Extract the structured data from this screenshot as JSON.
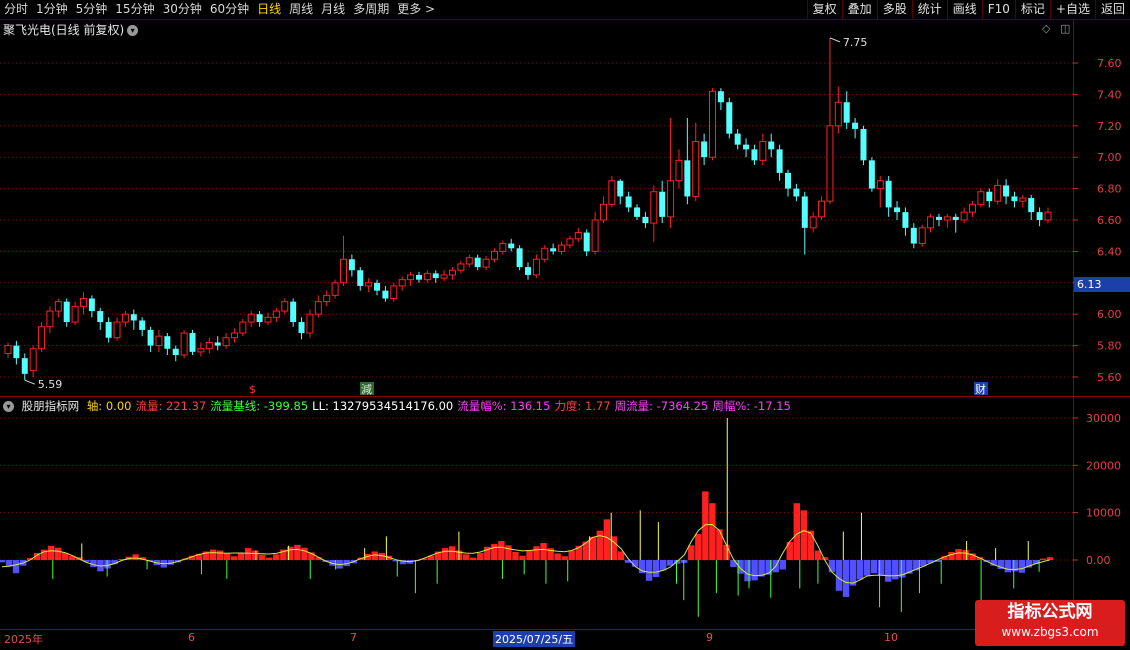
{
  "toolbar": {
    "periods": [
      "分时",
      "1分钟",
      "5分钟",
      "15分钟",
      "30分钟",
      "60分钟",
      "日线",
      "周线",
      "月线",
      "多周期",
      "更多 >"
    ],
    "active_period": "日线",
    "tools": [
      "复权",
      "叠加",
      "多股",
      "统计",
      "画线",
      "F10",
      "标记",
      "+自选",
      "返回"
    ]
  },
  "stock": {
    "title": "聚飞光电(日线 前复权)"
  },
  "price_axis": {
    "ticks": [
      "7.60",
      "7.40",
      "7.20",
      "7.00",
      "6.80",
      "6.60",
      "6.40",
      "6.20",
      "6.00",
      "5.80",
      "5.60"
    ],
    "current": "6.13"
  },
  "annotations": {
    "high": "7.75",
    "low": "5.59"
  },
  "event_markers": [
    {
      "text": "$",
      "color": "#ff3030"
    },
    {
      "text": "減",
      "color": "#e0e0e0",
      "bg": "#2a6e2a"
    },
    {
      "text": "财",
      "color": "#ffffff",
      "bg": "#1c3fa8"
    }
  ],
  "indicator": {
    "name": "股朋指标网",
    "fields": [
      {
        "label": "轴:",
        "value": "0.00",
        "color": "#ffd700"
      },
      {
        "label": "流量:",
        "value": "221.37",
        "color": "#ff4040"
      },
      {
        "label": "流量基线:",
        "value": "-399.85",
        "color": "#40ff40"
      },
      {
        "label": "LL:",
        "value": "13279534514176.00",
        "color": "#ffffff"
      },
      {
        "label": "流量幅%:",
        "value": "136.15",
        "color": "#ff40ff"
      },
      {
        "label": "力度:",
        "value": "1.77",
        "color": "#ff4040"
      },
      {
        "label": "周流量:",
        "value": "-7364.25",
        "color": "#ff40ff"
      },
      {
        "label": "周幅%:",
        "value": "-17.15",
        "color": "#ff40ff"
      }
    ],
    "axis_ticks": [
      "30000",
      "20000",
      "10000",
      "0.00"
    ]
  },
  "date_axis": {
    "labels": [
      "2025年",
      "6",
      "7",
      "9",
      "10"
    ],
    "cursor": "2025/07/25/五"
  },
  "watermark": {
    "line1": "指标公式网",
    "line2": "www.zbgs3.com"
  },
  "colors": {
    "up": "#ff2020",
    "down": "#54ffff",
    "flow_pos": "#ff2020",
    "flow_neg": "#5050ff",
    "baseline": "#40ff40"
  },
  "chart_data": {
    "type": "candlestick",
    "price_range": [
      5.55,
      7.78
    ],
    "candles": [
      [
        5.75,
        5.8,
        5.72,
        5.82
      ],
      [
        5.8,
        5.72,
        5.68,
        5.83
      ],
      [
        5.72,
        5.62,
        5.58,
        5.75
      ],
      [
        5.64,
        5.78,
        5.6,
        5.8
      ],
      [
        5.78,
        5.92,
        5.76,
        5.95
      ],
      [
        5.92,
        6.02,
        5.88,
        6.05
      ],
      [
        6.02,
        6.08,
        5.98,
        6.1
      ],
      [
        6.08,
        5.95,
        5.92,
        6.1
      ],
      [
        5.95,
        6.05,
        5.93,
        6.08
      ],
      [
        6.05,
        6.1,
        6.0,
        6.14
      ],
      [
        6.1,
        6.02,
        5.98,
        6.12
      ],
      [
        6.02,
        5.95,
        5.9,
        6.04
      ],
      [
        5.95,
        5.85,
        5.82,
        5.98
      ],
      [
        5.85,
        5.95,
        5.83,
        5.98
      ],
      [
        5.95,
        6.0,
        5.92,
        6.02
      ],
      [
        6.0,
        5.96,
        5.9,
        6.03
      ],
      [
        5.96,
        5.9,
        5.86,
        5.98
      ],
      [
        5.9,
        5.8,
        5.76,
        5.92
      ],
      [
        5.8,
        5.86,
        5.76,
        5.9
      ],
      [
        5.86,
        5.78,
        5.74,
        5.88
      ],
      [
        5.78,
        5.74,
        5.7,
        5.8
      ],
      [
        5.74,
        5.88,
        5.72,
        5.9
      ],
      [
        5.88,
        5.76,
        5.74,
        5.9
      ],
      [
        5.76,
        5.78,
        5.73,
        5.82
      ],
      [
        5.78,
        5.82,
        5.75,
        5.85
      ],
      [
        5.82,
        5.8,
        5.77,
        5.86
      ],
      [
        5.8,
        5.85,
        5.78,
        5.88
      ],
      [
        5.85,
        5.88,
        5.82,
        5.91
      ],
      [
        5.88,
        5.95,
        5.86,
        5.97
      ],
      [
        5.95,
        6.0,
        5.92,
        6.02
      ],
      [
        6.0,
        5.95,
        5.92,
        6.02
      ],
      [
        5.95,
        5.98,
        5.93,
        6.01
      ],
      [
        5.98,
        6.02,
        5.95,
        6.04
      ],
      [
        6.02,
        6.08,
        6.0,
        6.1
      ],
      [
        6.08,
        5.95,
        5.92,
        6.1
      ],
      [
        5.95,
        5.88,
        5.84,
        5.98
      ],
      [
        5.88,
        6.0,
        5.85,
        6.03
      ],
      [
        6.0,
        6.08,
        5.98,
        6.12
      ],
      [
        6.08,
        6.12,
        6.05,
        6.15
      ],
      [
        6.12,
        6.2,
        6.1,
        6.22
      ],
      [
        6.2,
        6.35,
        6.18,
        6.5
      ],
      [
        6.35,
        6.28,
        6.24,
        6.38
      ],
      [
        6.28,
        6.18,
        6.15,
        6.3
      ],
      [
        6.18,
        6.2,
        6.14,
        6.23
      ],
      [
        6.2,
        6.15,
        6.12,
        6.22
      ],
      [
        6.15,
        6.1,
        6.08,
        6.18
      ],
      [
        6.1,
        6.18,
        6.08,
        6.2
      ],
      [
        6.18,
        6.22,
        6.15,
        6.24
      ],
      [
        6.22,
        6.25,
        6.18,
        6.27
      ],
      [
        6.25,
        6.22,
        6.2,
        6.27
      ],
      [
        6.22,
        6.26,
        6.2,
        6.28
      ],
      [
        6.26,
        6.23,
        6.2,
        6.28
      ],
      [
        6.23,
        6.25,
        6.21,
        6.28
      ],
      [
        6.25,
        6.28,
        6.22,
        6.3
      ],
      [
        6.28,
        6.32,
        6.26,
        6.34
      ],
      [
        6.32,
        6.36,
        6.3,
        6.38
      ],
      [
        6.36,
        6.3,
        6.28,
        6.38
      ],
      [
        6.3,
        6.35,
        6.28,
        6.37
      ],
      [
        6.35,
        6.4,
        6.33,
        6.42
      ],
      [
        6.4,
        6.45,
        6.38,
        6.47
      ],
      [
        6.45,
        6.42,
        6.4,
        6.48
      ],
      [
        6.42,
        6.3,
        6.28,
        6.44
      ],
      [
        6.3,
        6.25,
        6.22,
        6.33
      ],
      [
        6.25,
        6.35,
        6.23,
        6.38
      ],
      [
        6.35,
        6.42,
        6.33,
        6.44
      ],
      [
        6.42,
        6.4,
        6.38,
        6.45
      ],
      [
        6.4,
        6.44,
        6.38,
        6.46
      ],
      [
        6.44,
        6.48,
        6.42,
        6.5
      ],
      [
        6.48,
        6.52,
        6.46,
        6.55
      ],
      [
        6.52,
        6.4,
        6.37,
        6.54
      ],
      [
        6.4,
        6.6,
        6.38,
        6.65
      ],
      [
        6.6,
        6.7,
        6.58,
        6.75
      ],
      [
        6.7,
        6.85,
        6.68,
        6.88
      ],
      [
        6.85,
        6.75,
        6.7,
        6.86
      ],
      [
        6.75,
        6.68,
        6.65,
        6.78
      ],
      [
        6.68,
        6.62,
        6.6,
        6.7
      ],
      [
        6.62,
        6.58,
        6.55,
        6.65
      ],
      [
        6.58,
        6.78,
        6.46,
        6.82
      ],
      [
        6.78,
        6.62,
        6.58,
        6.85
      ],
      [
        6.62,
        6.85,
        6.55,
        7.25
      ],
      [
        6.85,
        6.98,
        6.8,
        7.05
      ],
      [
        6.98,
        6.75,
        6.7,
        7.25
      ],
      [
        6.75,
        7.1,
        6.72,
        7.22
      ],
      [
        7.1,
        7.0,
        6.95,
        7.15
      ],
      [
        7.0,
        7.42,
        6.98,
        7.44
      ],
      [
        7.42,
        7.35,
        7.3,
        7.44
      ],
      [
        7.35,
        7.15,
        7.12,
        7.38
      ],
      [
        7.15,
        7.08,
        7.05,
        7.18
      ],
      [
        7.08,
        7.05,
        7.0,
        7.12
      ],
      [
        7.05,
        6.98,
        6.95,
        7.08
      ],
      [
        6.98,
        7.1,
        6.95,
        7.15
      ],
      [
        7.1,
        7.05,
        7.0,
        7.15
      ],
      [
        7.05,
        6.9,
        6.85,
        7.08
      ],
      [
        6.9,
        6.8,
        6.75,
        6.92
      ],
      [
        6.8,
        6.75,
        6.72,
        6.83
      ],
      [
        6.75,
        6.55,
        6.38,
        6.78
      ],
      [
        6.55,
        6.62,
        6.52,
        6.65
      ],
      [
        6.62,
        6.72,
        6.6,
        6.75
      ],
      [
        6.72,
        7.2,
        6.7,
        7.76
      ],
      [
        7.2,
        7.35,
        7.15,
        7.45
      ],
      [
        7.35,
        7.22,
        7.18,
        7.42
      ],
      [
        7.22,
        7.18,
        7.12,
        7.25
      ],
      [
        7.18,
        6.98,
        6.95,
        7.2
      ],
      [
        6.98,
        6.8,
        6.78,
        7.0
      ],
      [
        6.8,
        6.85,
        6.68,
        6.88
      ],
      [
        6.85,
        6.68,
        6.62,
        6.88
      ],
      [
        6.68,
        6.65,
        6.6,
        6.72
      ],
      [
        6.65,
        6.55,
        6.5,
        6.68
      ],
      [
        6.55,
        6.45,
        6.42,
        6.58
      ],
      [
        6.45,
        6.55,
        6.43,
        6.57
      ],
      [
        6.55,
        6.62,
        6.52,
        6.64
      ],
      [
        6.62,
        6.6,
        6.56,
        6.64
      ],
      [
        6.6,
        6.62,
        6.55,
        6.64
      ],
      [
        6.62,
        6.6,
        6.52,
        6.64
      ],
      [
        6.6,
        6.65,
        6.58,
        6.68
      ],
      [
        6.65,
        6.7,
        6.62,
        6.72
      ],
      [
        6.7,
        6.78,
        6.68,
        6.8
      ],
      [
        6.78,
        6.72,
        6.68,
        6.8
      ],
      [
        6.72,
        6.82,
        6.7,
        6.86
      ],
      [
        6.82,
        6.75,
        6.7,
        6.86
      ],
      [
        6.75,
        6.72,
        6.68,
        6.78
      ],
      [
        6.72,
        6.74,
        6.68,
        6.76
      ],
      [
        6.74,
        6.65,
        6.6,
        6.76
      ],
      [
        6.65,
        6.6,
        6.56,
        6.68
      ],
      [
        6.6,
        6.65,
        6.58,
        6.68
      ]
    ],
    "flow_values": [
      -500,
      -1400,
      -2800,
      -1200,
      400,
      1500,
      2200,
      3000,
      2600,
      1500,
      900,
      600,
      -400,
      -1500,
      -2400,
      -1800,
      -900,
      200,
      700,
      1200,
      600,
      -300,
      -1100,
      -1600,
      -1000,
      -500,
      300,
      900,
      1300,
      1800,
      2200,
      2000,
      1400,
      800,
      1500,
      2500,
      2000,
      1100,
      500,
      1200,
      2200,
      2800,
      3200,
      2600,
      1600,
      600,
      -400,
      -1200,
      -1800,
      -1300,
      -700,
      500,
      1300,
      1800,
      1500,
      900,
      -300,
      -900,
      -800,
      -200,
      300,
      900,
      1800,
      2500,
      2900,
      2000,
      1200,
      500,
      1500,
      2800,
      3400,
      4000,
      3100,
      1700,
      900,
      2100,
      2900,
      3600,
      2500,
      1400,
      800,
      2000,
      3000,
      3900,
      4900,
      6200,
      8600,
      5000,
      1800,
      -600,
      -1400,
      -2800,
      -4400,
      -3600,
      -2200,
      -1200,
      -800,
      -600,
      3100,
      5500,
      14500,
      12000,
      6500,
      3200,
      -1500,
      -2900,
      -4500,
      -4300,
      -3500,
      -3100,
      -2600,
      -2000,
      3800,
      12000,
      10500,
      6200,
      2000,
      600,
      -2600,
      -6500,
      -7800,
      -5400,
      -4100,
      -3300,
      -2800,
      -3200,
      -4600,
      -4100,
      -3700,
      -2900,
      -2200,
      -1300,
      -700,
      -400,
      800,
      1700,
      2300,
      2100,
      1400,
      600,
      -400,
      -1200,
      -1900,
      -2600,
      -2400,
      -2700,
      -1600,
      -800,
      300,
      600
    ],
    "flow_spikes": [
      [
        14,
        -4000
      ],
      [
        22,
        3500
      ],
      [
        29,
        -3500
      ],
      [
        40,
        -2000
      ],
      [
        55,
        -3000
      ],
      [
        62,
        -4000
      ],
      [
        70,
        2000
      ],
      [
        79,
        3000
      ],
      [
        85,
        -4000
      ],
      [
        92,
        -2000
      ],
      [
        100,
        2500
      ],
      [
        106,
        5000
      ],
      [
        109,
        -3500
      ],
      [
        114,
        -7000
      ],
      [
        120,
        -5000
      ],
      [
        126,
        6000
      ],
      [
        138,
        -4000
      ],
      [
        144,
        -3000
      ],
      [
        150,
        -5000
      ],
      [
        156,
        -4500
      ],
      [
        162,
        5000
      ],
      [
        168,
        10000
      ],
      [
        176,
        10500
      ],
      [
        181,
        8000
      ],
      [
        186,
        -5000
      ],
      [
        188,
        -8500
      ],
      [
        192,
        -12000
      ],
      [
        197,
        -7000
      ],
      [
        200,
        30000
      ],
      [
        203,
        -7500
      ],
      [
        206,
        -6000
      ],
      [
        212,
        -8000
      ],
      [
        220,
        -6000
      ],
      [
        225,
        -5000
      ],
      [
        232,
        6000
      ],
      [
        237,
        10000
      ],
      [
        242,
        -10000
      ],
      [
        248,
        -11000
      ],
      [
        253,
        -7000
      ],
      [
        259,
        -5000
      ],
      [
        266,
        4000
      ],
      [
        270,
        -9000
      ],
      [
        274,
        2500
      ],
      [
        279,
        -6000
      ],
      [
        283,
        4000
      ],
      [
        286,
        -2500
      ]
    ],
    "flow_range": [
      -14000,
      32000
    ]
  }
}
